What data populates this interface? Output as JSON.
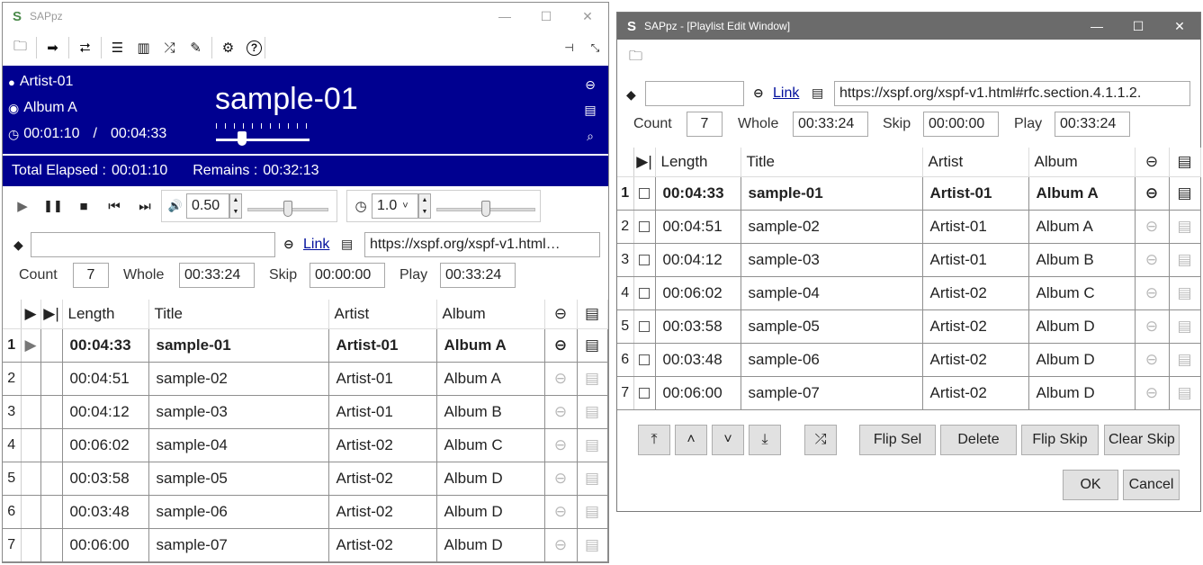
{
  "main_window": {
    "title": "SAPpz",
    "window_buttons": {
      "minimize": "—",
      "maximize": "☐",
      "close": "✕"
    },
    "toolbar": {
      "open": "🗀",
      "next": "➡",
      "repeat": "⮂",
      "list": "☰",
      "columns": "▥",
      "shuffle": "⤮",
      "edit": "✎",
      "settings": "⚙",
      "help": "?",
      "pin": "⊣",
      "shrink": "⤡"
    },
    "now_playing": {
      "artist": "Artist-01",
      "album": "Album A",
      "position": "00:01:10",
      "separator": "/",
      "duration": "00:04:33",
      "title": "sample-01",
      "progress": 0.26,
      "total_elapsed_label": "Total Elapsed :",
      "total_elapsed": "00:01:10",
      "remains_label": "Remains :",
      "remains": "00:32:13"
    },
    "controls": {
      "play": "▶",
      "pause": "❚❚",
      "stop": "■",
      "prev": "⏮",
      "next": "⏭",
      "volume_icon": "🔊",
      "volume": "0.50",
      "volume_level": 0.5,
      "speed_icon": "◷",
      "speed": "1.0",
      "speed_arrow": "˅",
      "speed_level": 0.5
    },
    "playlist_info": {
      "name": "",
      "link_label": "Link",
      "url": "https://xspf.org/xspf-v1.html…",
      "count_label": "Count",
      "count": "7",
      "whole_label": "Whole",
      "whole": "00:33:24",
      "skip_label": "Skip",
      "skip": "00:00:00",
      "play_label": "Play",
      "play": "00:33:24"
    }
  },
  "edit_window": {
    "title": "SAPpz - [Playlist Edit Window]",
    "window_buttons": {
      "minimize": "—",
      "maximize": "☐",
      "close": "✕"
    },
    "playlist_info": {
      "name": "",
      "link_label": "Link",
      "url": "https://xspf.org/xspf-v1.html#rfc.section.4.1.1.2.",
      "count_label": "Count",
      "count": "7",
      "whole_label": "Whole",
      "whole": "00:33:24",
      "skip_label": "Skip",
      "skip": "00:00:00",
      "play_label": "Play",
      "play": "00:33:24"
    },
    "buttons": {
      "top": "⤒",
      "up": "˄",
      "down": "˅",
      "bottom": "⤓",
      "shuffle": "⤮",
      "flip_sel": "Flip Sel",
      "delete": "Delete",
      "flip_skip": "Flip Skip",
      "clear_skip": "Clear Skip",
      "ok": "OK",
      "cancel": "Cancel"
    }
  },
  "table": {
    "columns": {
      "play": "▶",
      "skip": "▶|",
      "length": "Length",
      "title": "Title",
      "artist": "Artist",
      "album": "Album",
      "link": "⊖",
      "comment": "▤"
    },
    "rows": [
      {
        "n": "1",
        "length": "00:04:33",
        "title": "sample-01",
        "artist": "Artist-01",
        "album": "Album A"
      },
      {
        "n": "2",
        "length": "00:04:51",
        "title": "sample-02",
        "artist": "Artist-01",
        "album": "Album A"
      },
      {
        "n": "3",
        "length": "00:04:12",
        "title": "sample-03",
        "artist": "Artist-01",
        "album": "Album B"
      },
      {
        "n": "4",
        "length": "00:06:02",
        "title": "sample-04",
        "artist": "Artist-02",
        "album": "Album C"
      },
      {
        "n": "5",
        "length": "00:03:58",
        "title": "sample-05",
        "artist": "Artist-02",
        "album": "Album D"
      },
      {
        "n": "6",
        "length": "00:03:48",
        "title": "sample-06",
        "artist": "Artist-02",
        "album": "Album D"
      },
      {
        "n": "7",
        "length": "00:06:00",
        "title": "sample-07",
        "artist": "Artist-02",
        "album": "Album D"
      }
    ],
    "current_marker": "▶",
    "link_icon": "⊖",
    "comment_icon": "▤"
  },
  "colors": {
    "panel": "#000090",
    "link": "#000e9c",
    "edit_titlebar": "#6b6b6b"
  }
}
